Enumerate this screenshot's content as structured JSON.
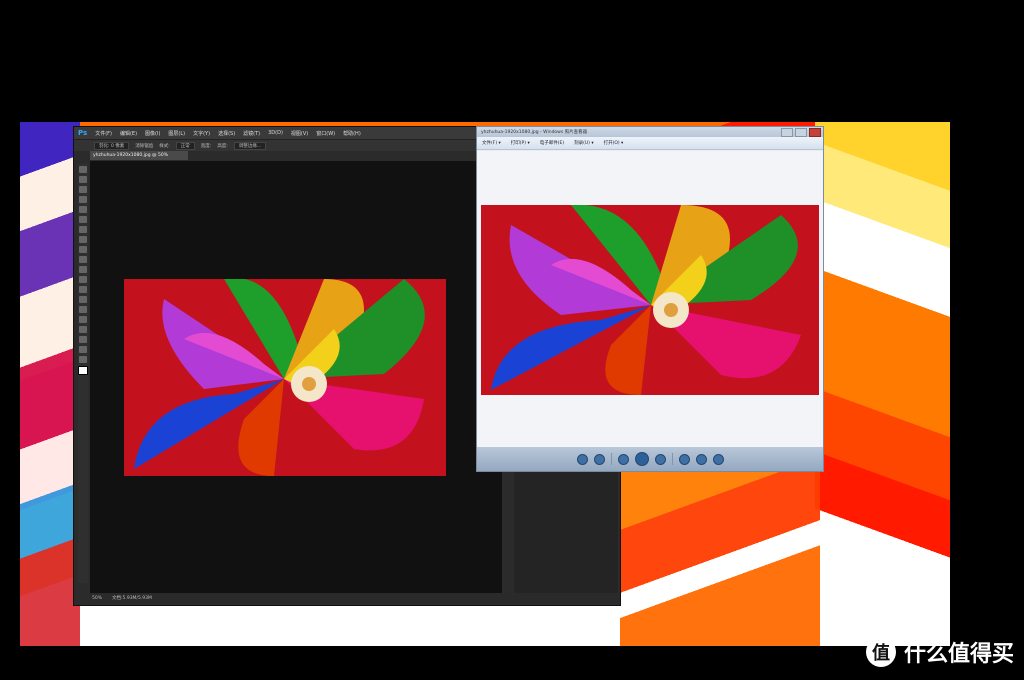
{
  "photoshop": {
    "logo": "Ps",
    "menus": [
      "文件(F)",
      "编辑(E)",
      "图像(I)",
      "图层(L)",
      "文字(Y)",
      "选择(S)",
      "滤镜(T)",
      "3D(D)",
      "视图(V)",
      "窗口(W)",
      "帮助(H)"
    ],
    "options": {
      "feather": "羽化: 0 像素",
      "antialias": "消除锯齿",
      "style_label": "样式:",
      "style_value": "正常",
      "width_label": "宽度:",
      "height_label": "高度:",
      "refine_edge": "调整边缘..."
    },
    "doc_tab": "yhzhuhua-1920x1080.jpg @ 50%(RGB/8#) ×",
    "status": {
      "zoom": "50%",
      "doc": "文档:5.93M/5.93M"
    }
  },
  "viewer": {
    "title": "yhzhuhua-1920x1080.jpg - Windows 照片查看器",
    "menus": [
      "文件(F) ▾",
      "打印(P) ▾",
      "电子邮件(E)",
      "刻录(U) ▾",
      "打开(O) ▾"
    ]
  },
  "watermark": {
    "icon": "值",
    "text": "什么值得买"
  },
  "colors": {
    "ps_accent": "#31a8ff",
    "viewer_frame": "#b7c6d8"
  }
}
